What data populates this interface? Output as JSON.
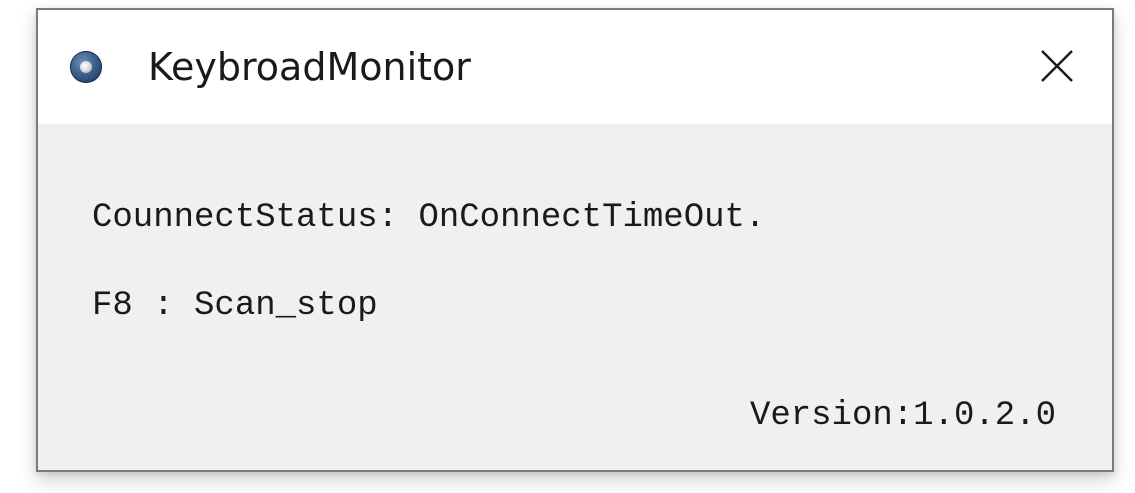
{
  "window": {
    "title": "KeybroadMonitor",
    "app_icon": "app-disc-icon",
    "close_icon": "close-icon"
  },
  "content": {
    "status_text": "CounnectStatus: OnConnectTimeOut.",
    "hotkey_text": "F8 : Scan_stop",
    "version_text": "Version:1.0.2.0"
  }
}
